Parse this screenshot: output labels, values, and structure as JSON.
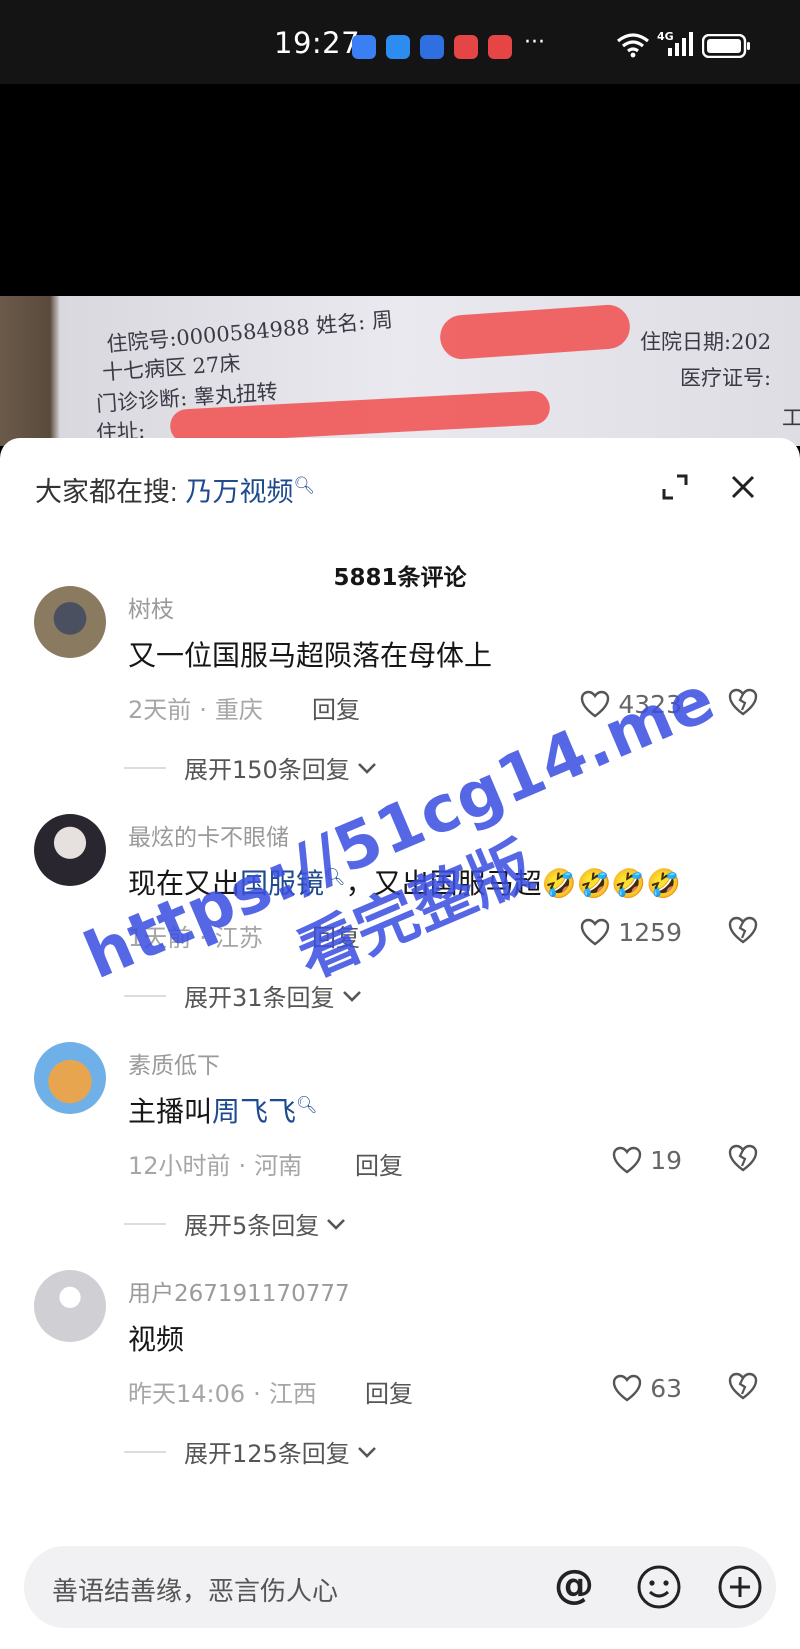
{
  "status_bar": {
    "time": "19:27",
    "network": "4G",
    "app_icons": [
      {
        "icon": "browser-icon",
        "color": "#3b7ff5"
      },
      {
        "icon": "message-icon",
        "color": "#2d8cf0"
      },
      {
        "icon": "cube-icon",
        "color": "#2f6fe0"
      },
      {
        "icon": "app-red-icon",
        "color": "#e64545"
      },
      {
        "icon": "app-red-icon",
        "color": "#e64545"
      }
    ],
    "more": "···"
  },
  "video": {
    "document_lines": [
      "住院号:0000584988  姓名: 周",
      "十七病区          27床",
      "门诊诊断: 睾丸扭转",
      "住址:",
      "住院日期:202",
      "医疗证号:",
      "工"
    ]
  },
  "sheet": {
    "search_label": "大家都在搜:",
    "search_term": "乃万视频",
    "comment_count": "5881条评论"
  },
  "comments": [
    {
      "username": "树枝",
      "content_parts": [
        {
          "text": "又一位国服马超陨落在母体上",
          "link": false
        }
      ],
      "time": "2天前",
      "location": "重庆",
      "reply": "回复",
      "likes": "4323",
      "expand": "展开150条回复"
    },
    {
      "username": "最炫的卡不眼储",
      "content_parts": [
        {
          "text": "现在又出",
          "link": false
        },
        {
          "text": "国服镜",
          "link": true
        },
        {
          "text": "，又出国服马超🤣🤣🤣🤣",
          "link": false
        }
      ],
      "time": "1天前",
      "location": "江苏",
      "reply": "回复",
      "likes": "1259",
      "expand": "展开31条回复"
    },
    {
      "username": "素质低下",
      "content_parts": [
        {
          "text": "主播叫",
          "link": false
        },
        {
          "text": "周飞飞",
          "link": true
        }
      ],
      "time": "12小时前",
      "location": "河南",
      "reply": "回复",
      "likes": "19",
      "expand": "展开5条回复"
    },
    {
      "username": "用户267191170777",
      "content_parts": [
        {
          "text": "视频",
          "link": false
        }
      ],
      "time": "昨天14:06",
      "location": "江西",
      "reply": "回复",
      "likes": "63",
      "expand": "展开125条回复"
    }
  ],
  "input_bar": {
    "placeholder": "善语结善缘，恶言伤人心"
  },
  "watermark": {
    "line1": "https://51cg14.me",
    "line2": "看完整版"
  },
  "colors": {
    "link": "#1f4a8f",
    "watermark": "#3a4fe0",
    "redaction": "#f05a5a"
  }
}
